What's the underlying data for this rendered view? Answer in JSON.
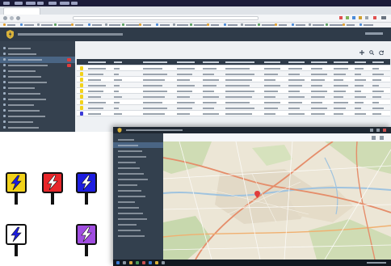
{
  "browser_window": {
    "menubar": {
      "items": [
        "",
        "",
        "",
        "",
        "",
        "",
        ""
      ]
    },
    "tabs": [
      ""
    ],
    "address_bar": {
      "url": ""
    },
    "app_header": {
      "title": ""
    },
    "sidebar": {
      "items": [
        {
          "label": "",
          "active": false,
          "badge": false
        },
        {
          "label": "",
          "active": false,
          "badge": false
        },
        {
          "label": "",
          "active": true,
          "badge": true
        },
        {
          "label": "",
          "active": false,
          "badge": true
        },
        {
          "label": "",
          "active": false,
          "badge": false
        },
        {
          "label": "",
          "active": false,
          "badge": false
        },
        {
          "label": "",
          "active": false,
          "badge": false
        },
        {
          "label": "",
          "active": false,
          "badge": false
        },
        {
          "label": "",
          "active": false,
          "badge": false
        },
        {
          "label": "",
          "active": false,
          "badge": false
        },
        {
          "label": "",
          "active": false,
          "badge": false
        },
        {
          "label": "",
          "active": false,
          "badge": false
        },
        {
          "label": "",
          "active": false,
          "badge": false
        },
        {
          "label": "",
          "active": false,
          "badge": false
        },
        {
          "label": "",
          "active": false,
          "badge": false
        }
      ]
    },
    "table": {
      "columns": [
        "",
        "",
        "",
        "",
        "",
        "",
        "",
        "",
        "",
        "",
        "",
        ""
      ],
      "rows": [
        {
          "pin_color": "#f2d21b"
        },
        {
          "pin_color": "#f2d21b"
        },
        {
          "pin_color": "#f2d21b"
        },
        {
          "pin_color": "#f2d21b"
        },
        {
          "pin_color": "#f2d21b"
        },
        {
          "pin_color": "#f2d21b"
        },
        {
          "pin_color": "#f2d21b"
        },
        {
          "pin_color": "#f2d21b"
        },
        {
          "pin_color": "#3a3ad8"
        }
      ]
    }
  },
  "map_window": {
    "title": "",
    "sidebar_items": [
      "",
      "",
      "",
      "",
      "",
      "",
      "",
      "",
      "",
      "",
      "",
      "",
      "",
      "",
      "",
      "",
      "",
      ""
    ],
    "marker_color": "#e03b3b"
  },
  "legend": {
    "items": [
      {
        "icon": "charger-pin-icon",
        "color": "#f2d21b",
        "label": "",
        "name": "legend-yellow"
      },
      {
        "icon": "charger-pin-icon",
        "color": "#e8262a",
        "label": "",
        "name": "legend-red"
      },
      {
        "icon": "charger-pin-icon",
        "color": "#1d1de0",
        "label": "",
        "name": "legend-blue"
      },
      {
        "icon": "charger-pin-icon",
        "color": "#ffffff",
        "label": "",
        "name": "legend-white"
      },
      {
        "icon": "charger-pin-icon",
        "color": "#a04de0",
        "label": "",
        "name": "legend-purple"
      }
    ]
  },
  "colors": {
    "app_header": "#2f3b49",
    "sidebar": "#35414f",
    "active_item": "#4a6584",
    "alert_badge": "#e03b3b"
  }
}
